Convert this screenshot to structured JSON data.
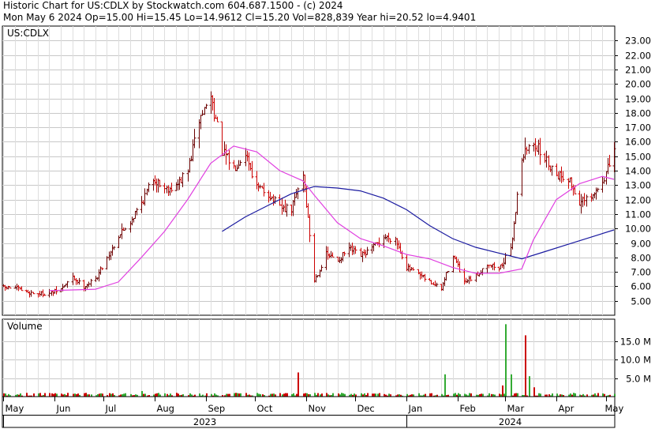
{
  "header": {
    "line1": "Historic Chart for US:CDLX by Stockwatch.com 604.687.1500 - (c) 2024",
    "line2": "Mon May  6 2024   Op=15.00   Hi=15.45   Lo=14.9612   Cl=15.20   Vol=828,839   Year hi=20.52   lo=4.9401"
  },
  "chart_data": [
    {
      "type": "ohlc",
      "panel": "price",
      "label": "US:CDLX",
      "ylim": [
        4,
        24
      ],
      "yticks": [
        "5.00",
        "6.00",
        "7.00",
        "8.00",
        "9.00",
        "10.00",
        "11.00",
        "12.00",
        "13.00",
        "14.00",
        "15.00",
        "16.00",
        "17.00",
        "18.00",
        "19.00",
        "20.00",
        "21.00",
        "22.00",
        "23.00"
      ],
      "grid": true,
      "colors": {
        "bar_up": "#6b0000",
        "bar_down": "#cc0000",
        "ma_short": "#e040e0",
        "ma_long": "#1a1aa0"
      },
      "close_path": [
        [
          "2023-05-08",
          5.9
        ],
        [
          "2023-05-15",
          5.6
        ],
        [
          "2023-05-22",
          5.5
        ],
        [
          "2023-05-29",
          5.5
        ],
        [
          "2023-06-05",
          5.8
        ],
        [
          "2023-06-12",
          6.6
        ],
        [
          "2023-06-19",
          6.0
        ],
        [
          "2023-06-26",
          6.5
        ],
        [
          "2023-07-03",
          8.0
        ],
        [
          "2023-07-10",
          9.5
        ],
        [
          "2023-07-17",
          10.5
        ],
        [
          "2023-07-24",
          11.8
        ],
        [
          "2023-07-31",
          13.5
        ],
        [
          "2023-08-07",
          12.8
        ],
        [
          "2023-08-14",
          12.9
        ],
        [
          "2023-08-21",
          14.0
        ],
        [
          "2023-08-28",
          17.5
        ],
        [
          "2023-09-04",
          19.2
        ],
        [
          "2023-09-11",
          15.3
        ],
        [
          "2023-09-18",
          14.2
        ],
        [
          "2023-09-25",
          15.3
        ],
        [
          "2023-10-02",
          12.8
        ],
        [
          "2023-10-09",
          12.4
        ],
        [
          "2023-10-16",
          11.4
        ],
        [
          "2023-10-23",
          11.3
        ],
        [
          "2023-10-30",
          13.8
        ],
        [
          "2023-11-06",
          6.4
        ],
        [
          "2023-11-13",
          8.2
        ],
        [
          "2023-11-20",
          7.8
        ],
        [
          "2023-11-27",
          8.6
        ],
        [
          "2023-12-04",
          8.1
        ],
        [
          "2023-12-11",
          8.6
        ],
        [
          "2023-12-18",
          9.4
        ],
        [
          "2023-12-25",
          9.3
        ],
        [
          "2024-01-01",
          7.3
        ],
        [
          "2024-01-08",
          6.8
        ],
        [
          "2024-01-15",
          6.3
        ],
        [
          "2024-01-22",
          5.8
        ],
        [
          "2024-01-29",
          8.2
        ],
        [
          "2024-02-05",
          6.2
        ],
        [
          "2024-02-12",
          6.7
        ],
        [
          "2024-02-19",
          7.6
        ],
        [
          "2024-02-26",
          7.2
        ],
        [
          "2024-03-04",
          8.5
        ],
        [
          "2024-03-11",
          15.0
        ],
        [
          "2024-03-18",
          16.0
        ],
        [
          "2024-03-25",
          14.8
        ],
        [
          "2024-04-01",
          13.8
        ],
        [
          "2024-04-08",
          13.5
        ],
        [
          "2024-04-15",
          11.8
        ],
        [
          "2024-04-22",
          12.0
        ],
        [
          "2024-04-29",
          13.3
        ],
        [
          "2024-05-06",
          15.2
        ]
      ],
      "ma_short": [
        [
          "2023-05-29",
          5.7
        ],
        [
          "2023-06-26",
          5.8
        ],
        [
          "2023-07-10",
          6.3
        ],
        [
          "2023-07-24",
          8.0
        ],
        [
          "2023-08-07",
          9.8
        ],
        [
          "2023-08-21",
          12.0
        ],
        [
          "2023-09-04",
          14.5
        ],
        [
          "2023-09-18",
          15.7
        ],
        [
          "2023-10-02",
          15.3
        ],
        [
          "2023-10-16",
          14.0
        ],
        [
          "2023-10-30",
          13.3
        ],
        [
          "2023-11-06",
          12.3
        ],
        [
          "2023-11-20",
          10.4
        ],
        [
          "2023-12-04",
          9.3
        ],
        [
          "2023-12-18",
          8.8
        ],
        [
          "2024-01-01",
          8.2
        ],
        [
          "2024-01-15",
          7.9
        ],
        [
          "2024-01-29",
          7.3
        ],
        [
          "2024-02-12",
          6.9
        ],
        [
          "2024-02-26",
          6.9
        ],
        [
          "2024-03-11",
          7.2
        ],
        [
          "2024-03-18",
          9.2
        ],
        [
          "2024-04-01",
          12.0
        ],
        [
          "2024-04-15",
          13.1
        ],
        [
          "2024-04-29",
          13.6
        ],
        [
          "2024-05-06",
          13.4
        ]
      ],
      "ma_long": [
        [
          "2023-09-11",
          9.8
        ],
        [
          "2023-09-25",
          10.8
        ],
        [
          "2023-10-09",
          11.6
        ],
        [
          "2023-10-23",
          12.4
        ],
        [
          "2023-11-06",
          12.9
        ],
        [
          "2023-11-20",
          12.8
        ],
        [
          "2023-12-04",
          12.6
        ],
        [
          "2023-12-18",
          12.1
        ],
        [
          "2024-01-01",
          11.3
        ],
        [
          "2024-01-15",
          10.2
        ],
        [
          "2024-01-29",
          9.3
        ],
        [
          "2024-02-12",
          8.7
        ],
        [
          "2024-02-26",
          8.3
        ],
        [
          "2024-03-11",
          7.9
        ],
        [
          "2024-03-25",
          8.4
        ],
        [
          "2024-04-08",
          8.9
        ],
        [
          "2024-04-22",
          9.4
        ],
        [
          "2024-05-06",
          9.9
        ]
      ]
    },
    {
      "type": "bar",
      "panel": "volume",
      "label": "Volume",
      "ylim": [
        0,
        20
      ],
      "unit": "M",
      "yticks": [
        "5.0 M",
        "10.0 M",
        "15.0 M"
      ],
      "base_millions": 0.6,
      "colors": {
        "up": "#33aa33",
        "down": "#cc0000"
      },
      "spikes": [
        [
          "2023-07-24",
          1.5,
          "up"
        ],
        [
          "2023-10-27",
          6.5,
          "down"
        ],
        [
          "2024-01-24",
          6.0,
          "up"
        ],
        [
          "2024-02-28",
          3.0,
          "down"
        ],
        [
          "2024-03-01",
          19.5,
          "up"
        ],
        [
          "2024-03-04",
          6.0,
          "up"
        ],
        [
          "2024-03-13",
          16.5,
          "down"
        ],
        [
          "2024-03-15",
          5.5,
          "up"
        ],
        [
          "2024-03-18",
          2.5,
          "down"
        ]
      ]
    }
  ],
  "xaxis": {
    "months": [
      {
        "label": "May",
        "date": "2023-05-01"
      },
      {
        "label": "Jun",
        "date": "2023-06-01"
      },
      {
        "label": "Jul",
        "date": "2023-07-01"
      },
      {
        "label": "Aug",
        "date": "2023-08-01"
      },
      {
        "label": "Sep",
        "date": "2023-09-01"
      },
      {
        "label": "Oct",
        "date": "2023-10-01"
      },
      {
        "label": "Nov",
        "date": "2023-11-01"
      },
      {
        "label": "Dec",
        "date": "2023-12-01"
      },
      {
        "label": "Jan",
        "date": "2024-01-01"
      },
      {
        "label": "Feb",
        "date": "2024-02-01"
      },
      {
        "label": "Mar",
        "date": "2024-03-01"
      },
      {
        "label": "Apr",
        "date": "2024-04-01"
      },
      {
        "label": "May",
        "date": "2024-05-01"
      }
    ],
    "years": [
      {
        "label": "2023",
        "from": "2023-05-01",
        "to": "2024-01-01"
      },
      {
        "label": "2024",
        "from": "2024-01-01",
        "to": "2024-05-06"
      }
    ],
    "start": "2023-05-01",
    "end": "2024-05-06"
  }
}
